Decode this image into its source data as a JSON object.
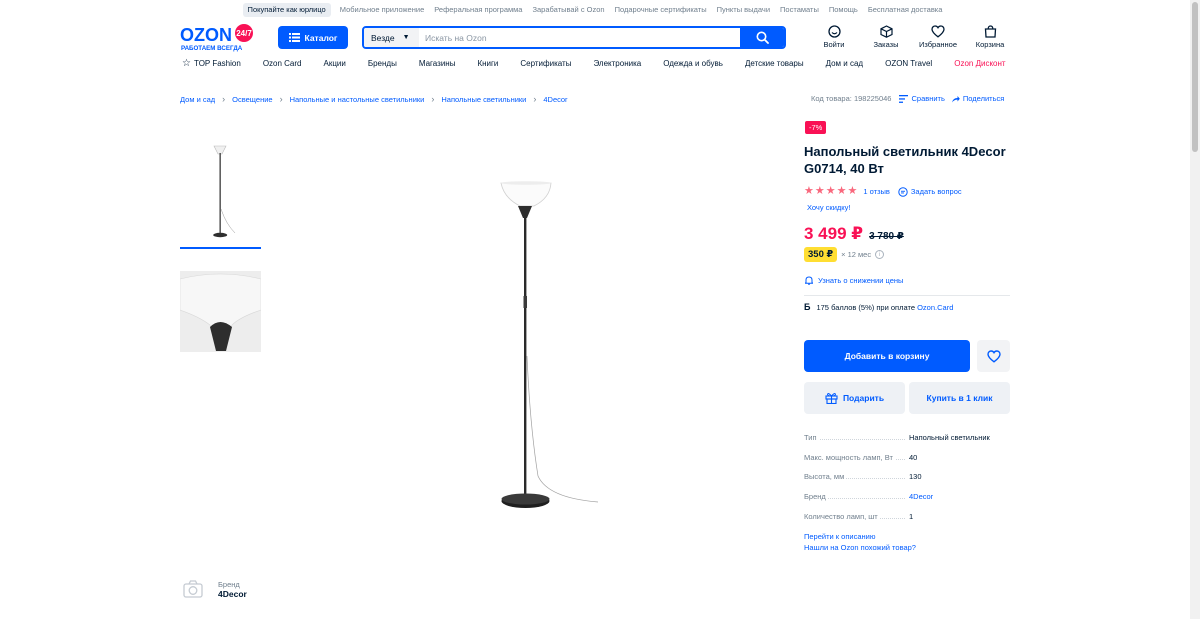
{
  "utility_links": [
    "Покупайте как юрлицо",
    "Мобильное приложение",
    "Реферальная программа",
    "Зарабатывай с Ozon",
    "Подарочные сертификаты",
    "Пункты выдачи",
    "Постаматы",
    "Помощь",
    "Бесплатная доставка"
  ],
  "logo": {
    "brand": "OZON",
    "tagline": "РАБОТАЕМ ВСЕГДА",
    "badge": "24/7"
  },
  "catalog_label": "Каталог",
  "search": {
    "scope": "Везде",
    "placeholder": "Искать на Ozon"
  },
  "header_actions": [
    "Войти",
    "Заказы",
    "Избранное",
    "Корзина"
  ],
  "nav": [
    "TOP Fashion",
    "Ozon Card",
    "Акции",
    "Бренды",
    "Магазины",
    "Книги",
    "Сертификаты",
    "Электроника",
    "Одежда и обувь",
    "Детские товары",
    "Дом и сад",
    "OZON Travel",
    "Ozon Дисконт"
  ],
  "breadcrumbs": [
    "Дом и сад",
    "Освещение",
    "Напольные и настольные светильники",
    "Напольные светильники",
    "4Decor"
  ],
  "product_code": "Код товара: 198225046",
  "compare_label": "Сравнить",
  "share_label": "Поделиться",
  "product": {
    "discount_badge": "-7%",
    "title": "Напольный светильник 4Decor G0714, 40 Вт",
    "rating": 5,
    "reviews": "1 отзыв",
    "ask_question": "Задать вопрос",
    "want_discount": "Хочу скидку!",
    "price": "3 499 ₽",
    "old_price": "3 780 ₽",
    "installment_amount": "350 ₽",
    "installment_term": "× 12 мес",
    "price_drop_notify": "Узнать о снижении цены",
    "points_letter": "Б",
    "points_text": "175 баллов (5%) при оплате",
    "points_link": "Ozon.Card",
    "add_to_cart": "Добавить в корзину",
    "gift": "Подарить",
    "buy_one_click": "Купить в 1 клик"
  },
  "specs": [
    {
      "key": "Тип",
      "value": "Напольный светильник"
    },
    {
      "key": "Макс. мощность ламп, Вт",
      "value": "40"
    },
    {
      "key": "Высота, мм",
      "value": "130"
    },
    {
      "key": "Бренд",
      "value": "4Decor"
    },
    {
      "key": "Количество ламп, шт",
      "value": "1"
    }
  ],
  "go_to_description": "Перейти к описанию",
  "found_cheaper": "Нашли на Ozon похожий товар?",
  "brand_block": {
    "label": "Бренд",
    "name": "4Decor"
  },
  "colors": {
    "accent": "#005bff",
    "sale": "#f91155",
    "installment": "#ffde32",
    "star": "#f9687d"
  }
}
